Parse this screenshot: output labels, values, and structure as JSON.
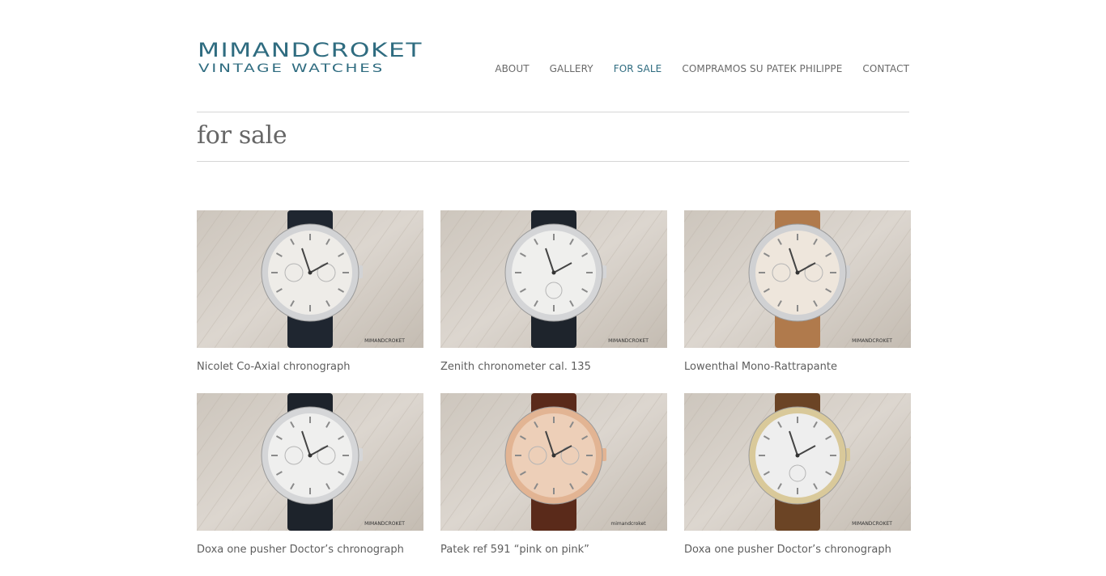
{
  "brand": {
    "line1": "MIMANDCROKET",
    "line2": "VINTAGE WATCHES",
    "color": "#2f6c80"
  },
  "nav": {
    "items": [
      {
        "label": "ABOUT",
        "active": false
      },
      {
        "label": "GALLERY",
        "active": false
      },
      {
        "label": "FOR SALE",
        "active": true
      },
      {
        "label": "COMPRAMOS SU PATEK PHILIPPE",
        "active": false
      },
      {
        "label": "CONTACT",
        "active": false
      }
    ]
  },
  "page": {
    "title": "for sale"
  },
  "watches": [
    {
      "caption": "Nicolet Co-Axial chronograph",
      "case": "#d2d3d5",
      "dial": "#eeece8",
      "strap": "#1f2630",
      "style": "chrono",
      "watermark": "MIMANDCROKET"
    },
    {
      "caption": "Zenith chronometer cal. 135",
      "case": "#d4d5d7",
      "dial": "#efefed",
      "strap": "#1e242c",
      "style": "simple",
      "watermark": "MIMANDCROKET"
    },
    {
      "caption": "Lowenthal Mono-Rattrapante",
      "case": "#d0d1d3",
      "dial": "#eee6dc",
      "strap": "#b07a4c",
      "style": "chrono",
      "watermark": "MIMANDCROKET"
    },
    {
      "caption": "Doxa one pusher Doctor’s chronograph",
      "case": "#d5d6d8",
      "dial": "#efefee",
      "strap": "#1d232b",
      "style": "chrono",
      "watermark": "MIMANDCROKET"
    },
    {
      "caption": "Patek ref 591 “pink on pink”",
      "case": "#e2b493",
      "dial": "#edcfb8",
      "strap": "#5a2a1a",
      "style": "chrono",
      "watermark": "mimandcroket"
    },
    {
      "caption": "Doxa one pusher Doctor’s chronograph",
      "case": "#d9c99a",
      "dial": "#eeeeee",
      "strap": "#6b4425",
      "style": "simple",
      "watermark": "MIMANDCROKET"
    }
  ]
}
